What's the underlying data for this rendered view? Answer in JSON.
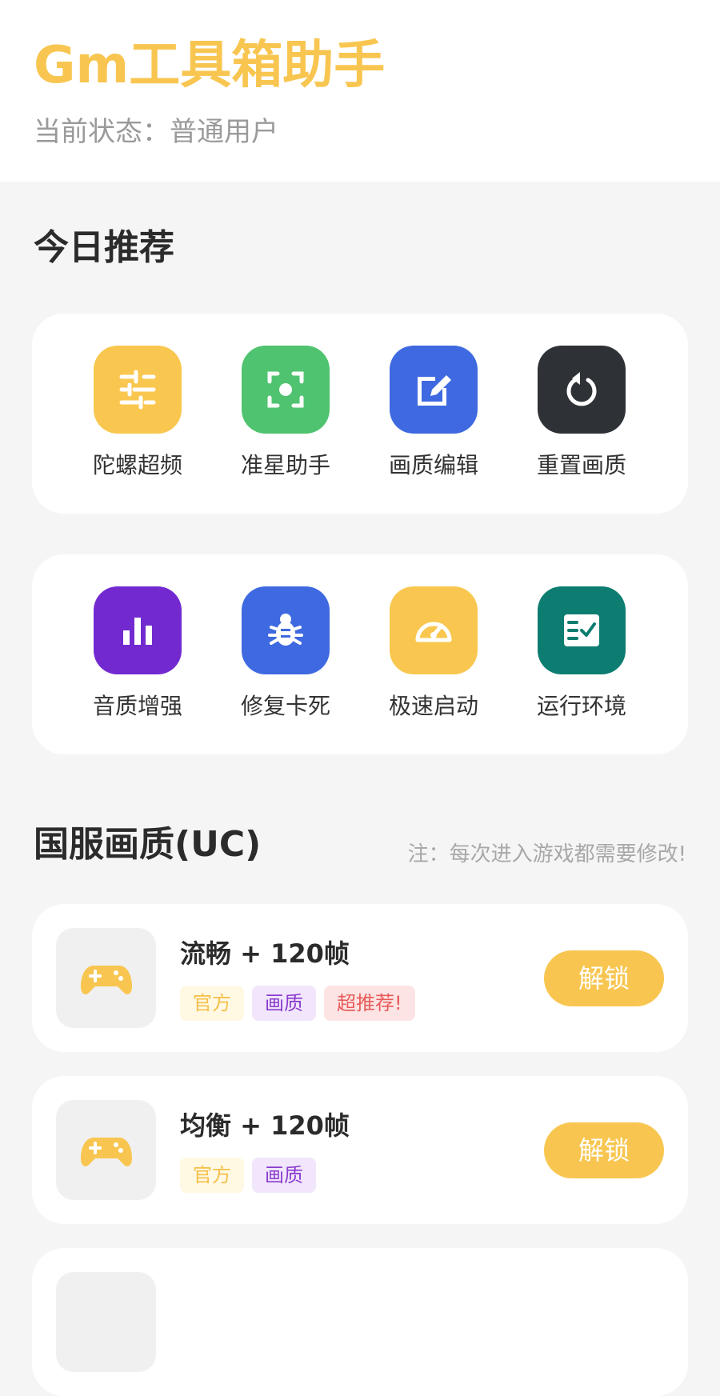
{
  "header": {
    "title": "Gm工具箱助手",
    "status": "当前状态：普通用户"
  },
  "recommend": {
    "title": "今日推荐",
    "rows": [
      [
        {
          "label": "陀螺超频",
          "icon": "sliders-icon",
          "color": "#f9c74f"
        },
        {
          "label": "准星助手",
          "icon": "crosshair-focus-icon",
          "color": "#4fc36f"
        },
        {
          "label": "画质编辑",
          "icon": "edit-icon",
          "color": "#3e69e0"
        },
        {
          "label": "重置画质",
          "icon": "reset-icon",
          "color": "#2e3236"
        }
      ],
      [
        {
          "label": "音质增强",
          "icon": "bar-chart-icon",
          "color": "#722ad0"
        },
        {
          "label": "修复卡死",
          "icon": "bug-icon",
          "color": "#3e69e0"
        },
        {
          "label": "极速启动",
          "icon": "speedometer-icon",
          "color": "#f9c74f"
        },
        {
          "label": "运行环境",
          "icon": "checklist-icon",
          "color": "#0c7d70"
        }
      ]
    ]
  },
  "cn_quality": {
    "title": "国服画质(UC)",
    "note": "注：每次进入游戏都需要修改!",
    "items": [
      {
        "name": "流畅 + 120帧",
        "tags": [
          "官方",
          "画质",
          "超推荐!"
        ],
        "button": "解锁",
        "icon": "gamepad-icon"
      },
      {
        "name": "均衡 + 120帧",
        "tags": [
          "官方",
          "画质"
        ],
        "button": "解锁",
        "icon": "gamepad-icon"
      }
    ]
  },
  "colors": {
    "accent": "#f8c650",
    "tag_official": "#f5c04a",
    "tag_quality": "#8a3ccf",
    "tag_hot": "#e85a5a"
  }
}
